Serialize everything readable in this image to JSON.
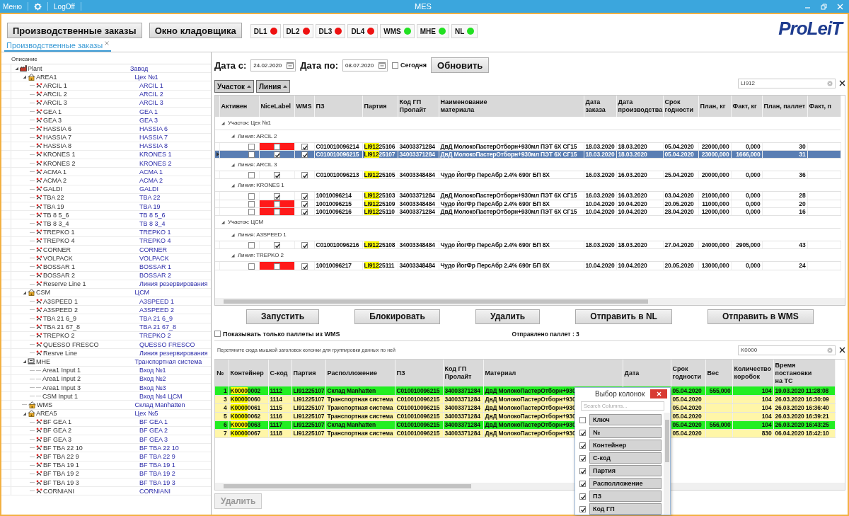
{
  "title_bar": {
    "menu": "Меню",
    "logoff": "LogOff",
    "title": "MES"
  },
  "toolbar": {
    "buttons": [
      "Производственные заказы",
      "Окно кладовщика"
    ],
    "indicators": [
      {
        "label": "DL1",
        "color": "#ee1111"
      },
      {
        "label": "DL2",
        "color": "#ee1111"
      },
      {
        "label": "DL3",
        "color": "#ee1111"
      },
      {
        "label": "DL4",
        "color": "#ee1111"
      },
      {
        "label": "WMS",
        "color": "#22e022"
      },
      {
        "label": "MHE",
        "color": "#22e022"
      },
      {
        "label": "NL",
        "color": "#22e022"
      }
    ],
    "logo": "ProLeiT"
  },
  "tabs": [
    {
      "label": "Производственные заказы",
      "selected": true
    }
  ],
  "tree": {
    "header": "Описание",
    "items": [
      {
        "name": "Plant",
        "value": "Завод",
        "kind": "plant",
        "expanded": true,
        "children": [
          {
            "name": "AREA1",
            "value": "Цех №1",
            "kind": "area",
            "expanded": true,
            "children": [
              {
                "name": "ARCIL 1",
                "value": "ARCIL 1",
                "kind": "line"
              },
              {
                "name": "ARCIL 2",
                "value": "ARCIL 2",
                "kind": "line"
              },
              {
                "name": "ARCIL 3",
                "value": "ARCIL 3",
                "kind": "line"
              },
              {
                "name": "GEA 1",
                "value": "GEA 1",
                "kind": "line"
              },
              {
                "name": "GEA 3",
                "value": "GEA 3",
                "kind": "line"
              },
              {
                "name": "HASSIA 6",
                "value": "HASSIA 6",
                "kind": "line"
              },
              {
                "name": "HASSIA 7",
                "value": "HASSIA 7",
                "kind": "line"
              },
              {
                "name": "HASSIA 8",
                "value": "HASSIA 8",
                "kind": "line"
              },
              {
                "name": "KRONES 1",
                "value": "KRONES 1",
                "kind": "line"
              },
              {
                "name": "KRONES 2",
                "value": "KRONES 2",
                "kind": "line"
              },
              {
                "name": "ACMA 1",
                "value": "ACMA 1",
                "kind": "line"
              },
              {
                "name": "ACMA 2",
                "value": "ACMA 2",
                "kind": "line"
              },
              {
                "name": "GALDI",
                "value": "GALDI",
                "kind": "line"
              },
              {
                "name": "TBA 22",
                "value": "TBA 22",
                "kind": "line"
              },
              {
                "name": "TBA 19",
                "value": "TBA 19",
                "kind": "line"
              },
              {
                "name": "TB 8 5_6",
                "value": "TB 8 5_6",
                "kind": "line"
              },
              {
                "name": "TB 8 3_4",
                "value": "TB 8 3_4",
                "kind": "line"
              },
              {
                "name": "TREPKO 1",
                "value": "TREPKO 1",
                "kind": "line"
              },
              {
                "name": "TREPKO 4",
                "value": "TREPKO 4",
                "kind": "line"
              },
              {
                "name": "CORNER",
                "value": "CORNER",
                "kind": "line"
              },
              {
                "name": "VOLPACK",
                "value": "VOLPACK",
                "kind": "line"
              },
              {
                "name": "BOSSAR 1",
                "value": "BOSSAR 1",
                "kind": "line"
              },
              {
                "name": "BOSSAR 2",
                "value": "BOSSAR 2",
                "kind": "line"
              },
              {
                "name": "Reserve Line 1",
                "value": "Линия резервирования",
                "kind": "line"
              }
            ]
          },
          {
            "name": "CSM",
            "value": "ЦСМ",
            "kind": "area",
            "expanded": true,
            "children": [
              {
                "name": "A3SPEED 1",
                "value": "A3SPEED 1",
                "kind": "line"
              },
              {
                "name": "A3SPEED 2",
                "value": "A3SPEED 2",
                "kind": "line"
              },
              {
                "name": "TBA 21 6_9",
                "value": "TBA 21 6_9",
                "kind": "line"
              },
              {
                "name": "TBA 21 67_8",
                "value": "TBA 21 67_8",
                "kind": "line"
              },
              {
                "name": "TREPKO 2",
                "value": "TREPKO 2",
                "kind": "line"
              },
              {
                "name": "QUESSO FRESCO",
                "value": "QUESSO FRESCO",
                "kind": "line"
              },
              {
                "name": "Resrve Line",
                "value": "Линия резервирования",
                "kind": "line"
              }
            ]
          },
          {
            "name": "MHE",
            "value": "Транспортная система",
            "kind": "transport",
            "expanded": true,
            "children": [
              {
                "name": "Area1 Input 1",
                "value": "Вход №1",
                "kind": "input"
              },
              {
                "name": "Area1 Input 2",
                "value": "Вход №2",
                "kind": "input"
              },
              {
                "name": "Area1 Input 3",
                "value": "Вход №3",
                "kind": "input"
              },
              {
                "name": "CSM Input 1",
                "value": "Вход №4 ЦСМ",
                "kind": "input"
              }
            ]
          },
          {
            "name": "WMS",
            "value": "Склад Manhatten",
            "kind": "area"
          },
          {
            "name": "AREA5",
            "value": "Цех №5",
            "kind": "area",
            "expanded": true,
            "children": [
              {
                "name": "BF GEA 1",
                "value": "BF GEA 1",
                "kind": "line"
              },
              {
                "name": "BF GEA 2",
                "value": "BF GEA 2",
                "kind": "line"
              },
              {
                "name": "BF GEA 3",
                "value": "BF GEA 3",
                "kind": "line"
              },
              {
                "name": "BF TBA 22 10",
                "value": "BF TBA 22 10",
                "kind": "line"
              },
              {
                "name": "BF TBA 22 9",
                "value": "BF TBA 22 9",
                "kind": "line"
              },
              {
                "name": "BF TBA 19 1",
                "value": "BF TBA 19 1",
                "kind": "line"
              },
              {
                "name": "BF TBA 19 2",
                "value": "BF TBA 19 2",
                "kind": "line"
              },
              {
                "name": "BF TBA 19 3",
                "value": "BF TBA 19 3",
                "kind": "line"
              },
              {
                "name": "CORNIANI",
                "value": "CORNIANI",
                "kind": "line"
              }
            ]
          }
        ]
      }
    ]
  },
  "filter": {
    "date_from_label": "Дата с:",
    "date_from": "24.02.2020",
    "date_to_label": "Дата по:",
    "date_to": "08.07.2020",
    "today": {
      "label": "Сегодня",
      "checked": false
    },
    "refresh": "Обновить"
  },
  "orders": {
    "group_by": [
      "Участок",
      "Линия"
    ],
    "search": "LI912",
    "columns": [
      "Активен",
      "NiceLabel",
      "WMS",
      "ПЗ",
      "Партия",
      "Код ГП\nПролайт",
      "Наименование\nматериала",
      "Дата\nзаказа",
      "Дата\nпроизводства",
      "Срок\nгодности",
      "План, кг",
      "Факт, кг",
      "План, паллет",
      "Факт, п"
    ],
    "groups": [
      {
        "label": "Участок: Цех №1",
        "expanded": true,
        "children": [
          {
            "label": "Линия: ARCIL 2",
            "expanded": true,
            "rows": [
              {
                "active": false,
                "nicelabel": false,
                "wms": true,
                "selected": false,
                "cells": [
                  "C010010096214",
                  {
                    "match": "LI912",
                    "rest": "25106"
                  },
                  "34003371284",
                  "ДвД МолокоПастерОтборн+930мл ПЭТ 6Х СГ15",
                  "18.03.2020",
                  "18.03.2020",
                  "05.04.2020",
                  "22000,000",
                  "0,000",
                  "30"
                ]
              },
              {
                "active": false,
                "nicelabel": true,
                "wms": true,
                "selected": true,
                "cells": [
                  "C010010096215",
                  {
                    "match": "LI912",
                    "rest": "25107"
                  },
                  "34003371284",
                  "ДвД МолокоПастерОтборн+930мл ПЭТ 6Х СГ15",
                  "18.03.2020",
                  "18.03.2020",
                  "05.04.2020",
                  "23000,000",
                  "1666,000",
                  "31"
                ]
              }
            ]
          },
          {
            "label": "Линия: ARCIL 3",
            "expanded": true,
            "rows": [
              {
                "active": false,
                "nicelabel": true,
                "wms": true,
                "selected": false,
                "cells": [
                  "C010010096213",
                  {
                    "match": "LI912",
                    "rest": "25105"
                  },
                  "34003348484",
                  "Чудо ЙогФр ПерсАбр 2.4% 690г БП 8Х",
                  "16.03.2020",
                  "16.03.2020",
                  "25.04.2020",
                  "20000,000",
                  "0,000",
                  "36"
                ]
              }
            ]
          },
          {
            "label": "Линия: KRONES 1",
            "expanded": true,
            "rows": [
              {
                "active": false,
                "nicelabel": true,
                "wms": true,
                "selected": false,
                "cells": [
                  "10010096214",
                  {
                    "match": "LI912",
                    "rest": "25103"
                  },
                  "34003371284",
                  "ДвД МолокоПастерОтборн+930мл ПЭТ 6Х СГ15",
                  "16.03.2020",
                  "16.03.2020",
                  "03.04.2020",
                  "21000,000",
                  "0,000",
                  "28"
                ]
              },
              {
                "active": false,
                "nicelabel": false,
                "wms": true,
                "selected": false,
                "cells": [
                  "10010096215",
                  {
                    "match": "LI912",
                    "rest": "25109"
                  },
                  "34003348484",
                  "Чудо ЙогФр ПерсАбр 2.4% 690г БП 8Х",
                  "10.04.2020",
                  "10.04.2020",
                  "20.05.2020",
                  "11000,000",
                  "0,000",
                  "20"
                ]
              },
              {
                "active": false,
                "nicelabel": false,
                "wms": true,
                "selected": false,
                "cells": [
                  "10010096216",
                  {
                    "match": "LI912",
                    "rest": "25110"
                  },
                  "34003371284",
                  "ДвД МолокоПастерОтборн+930мл ПЭТ 6Х СГ15",
                  "10.04.2020",
                  "10.04.2020",
                  "28.04.2020",
                  "12000,000",
                  "0,000",
                  "16"
                ]
              }
            ]
          }
        ]
      },
      {
        "label": "Участок: ЦСМ",
        "expanded": true,
        "children": [
          {
            "label": "Линия: A3SPEED 1",
            "expanded": true,
            "rows": [
              {
                "active": false,
                "nicelabel": true,
                "wms": true,
                "selected": false,
                "cells": [
                  "C010010096216",
                  {
                    "match": "LI912",
                    "rest": "25108"
                  },
                  "34003348484",
                  "Чудо ЙогФр ПерсАбр 2.4% 690г БП 8Х",
                  "18.03.2020",
                  "18.03.2020",
                  "27.04.2020",
                  "24000,000",
                  "2905,000",
                  "43"
                ]
              }
            ]
          },
          {
            "label": "Линия: TREPKO 2",
            "expanded": true,
            "rows": [
              {
                "active": false,
                "nicelabel": false,
                "wms": true,
                "selected": false,
                "cells": [
                  "10010096217",
                  {
                    "match": "LI912",
                    "rest": "25111"
                  },
                  "34003348484",
                  "Чудо ЙогФр ПерсАбр 2.4% 690г БП 8Х",
                  "10.04.2020",
                  "10.04.2020",
                  "20.05.2020",
                  "13000,000",
                  "0,000",
                  "24"
                ]
              }
            ]
          }
        ]
      }
    ]
  },
  "actions": [
    "Запустить",
    "Блокировать",
    "Удалить",
    "Отправить в NL",
    "Отправить в WMS"
  ],
  "pallets": {
    "wms_only": {
      "label": "Показывать только паллеты из WMS",
      "checked": false
    },
    "sent": "Отправлено паллет : 3",
    "group_hint": "Перетяните сюда мышкой заголовок колонки для группировки данных по ней",
    "search": "K0000",
    "columns": [
      "№",
      "Контейнер",
      "С-код",
      "Партия",
      "Располложение",
      "ПЗ",
      "Код ГП\nПролайт",
      "Материал",
      "Дата",
      "Срок\nгодности",
      "Вес",
      "Количество\nкоробок",
      "Время\nпостановки\nна ТС"
    ],
    "rows": [
      {
        "color": "#22ee22",
        "no": "1",
        "container": {
          "match": "K0000",
          "rest": "0002"
        },
        "code": "1112",
        "batch": "LI91225107",
        "location": "Склад Manhatten",
        "pz": "C010010096215",
        "gp": "34003371284",
        "material": "ДвД МолокоПастерОтборн+930",
        "expiry": "05.04.2020",
        "weight": "555,000",
        "boxes": "104",
        "time": "19.03.2020 11:28:08"
      },
      {
        "color": "#fff6a8",
        "no": "3",
        "container": {
          "match": "K0000",
          "rest": "0060"
        },
        "code": "1114",
        "batch": "LI91225107",
        "location": "Транспортная система",
        "pz": "C010010096215",
        "gp": "34003371284",
        "material": "ДвД МолокоПастерОтборн+930",
        "expiry": "05.04.2020",
        "boxes": "104",
        "time": "26.03.2020 16:30:09"
      },
      {
        "color": "#fff6a8",
        "no": "4",
        "container": {
          "match": "K0000",
          "rest": "0061"
        },
        "code": "1115",
        "batch": "LI91225107",
        "location": "Транспортная система",
        "pz": "C010010096215",
        "gp": "34003371284",
        "material": "ДвД МолокоПастерОтборн+930",
        "expiry": "05.04.2020",
        "boxes": "104",
        "time": "26.03.2020 16:36:40"
      },
      {
        "color": "#fff6a8",
        "no": "5",
        "container": {
          "match": "K0000",
          "rest": "0062"
        },
        "code": "1116",
        "batch": "LI91225107",
        "location": "Транспортная система",
        "pz": "C010010096215",
        "gp": "34003371284",
        "material": "ДвД МолокоПастерОтборн+930",
        "expiry": "05.04.2020",
        "boxes": "104",
        "time": "26.03.2020 16:39:21"
      },
      {
        "color": "#22ee22",
        "no": "6",
        "container": {
          "match": "K0000",
          "rest": "0063"
        },
        "code": "1117",
        "batch": "LI91225107",
        "location": "Склад Manhatten",
        "pz": "C010010096215",
        "gp": "34003371284",
        "material": "ДвД МолокоПастерОтборн+930",
        "expiry": "05.04.2020",
        "weight": "556,000",
        "boxes": "104",
        "time": "26.03.2020 16:43:25"
      },
      {
        "color": "#fff6a8",
        "no": "7",
        "container": {
          "match": "K0000",
          "rest": "0067"
        },
        "code": "1118",
        "batch": "LI91225107",
        "location": "Транспортная система",
        "pz": "C010010096215",
        "gp": "34003371284",
        "material": "ДвД МолокоПастерОтборн+930",
        "expiry": "05.04.2020",
        "boxes": "830",
        "time": "06.04.2020 18:42:10"
      }
    ]
  },
  "column_chooser": {
    "title": "Выбор колонок",
    "placeholder": "Search Columns...",
    "items": [
      {
        "label": "Ключ",
        "checked": false
      },
      {
        "label": "№",
        "checked": true
      },
      {
        "label": "Контейнер",
        "checked": true
      },
      {
        "label": "С-код",
        "checked": true
      },
      {
        "label": "Партия",
        "checked": true
      },
      {
        "label": "Располложение",
        "checked": true
      },
      {
        "label": "ПЗ",
        "checked": true
      },
      {
        "label": "Код ГП",
        "checked": true
      }
    ]
  },
  "delete_button": {
    "label": "Удалить",
    "disabled": true
  }
}
